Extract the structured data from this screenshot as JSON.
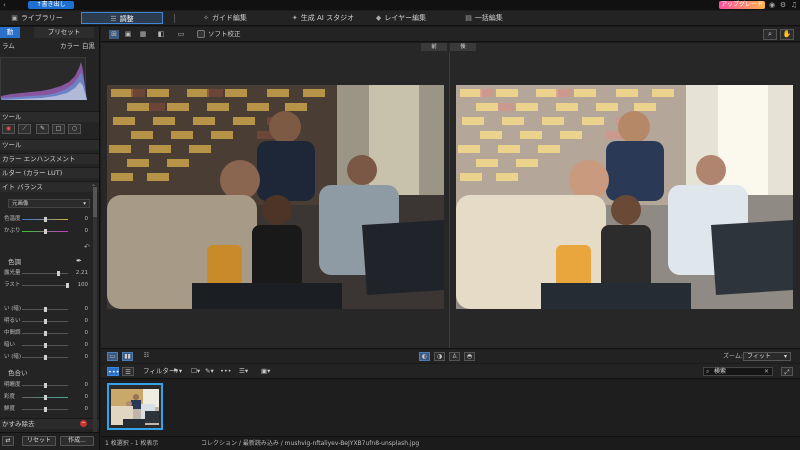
{
  "topbar": {
    "back_icon": "arrow-left-icon",
    "title_button": "↑書き出し",
    "upgrade_label": "アップグレード",
    "icons": [
      "account-icon",
      "gear-icon",
      "bell-icon",
      "help-icon"
    ]
  },
  "tabs": [
    {
      "label": "ライブラリー",
      "icon": "▣"
    },
    {
      "label": "調整",
      "icon": "☰",
      "active": true
    },
    {
      "label": "ガイド編集",
      "icon": "✧"
    },
    {
      "label": "生成 AI スタジオ",
      "icon": "✦"
    },
    {
      "label": "レイヤー編集",
      "icon": "◆"
    },
    {
      "label": "一括編集",
      "icon": "▤"
    }
  ],
  "left_panel": {
    "subtabs": [
      "動",
      "プリセット"
    ],
    "histogram_label": "ラム",
    "histogram_modes": [
      "カラー",
      "白黒"
    ],
    "tools_label": "ツール",
    "tools": [
      "eye-icon",
      "brush-icon",
      "pen-icon",
      "square-icon",
      "circle-icon"
    ],
    "section_tools": "ツール",
    "sections": [
      "カラー エンハンスメント",
      "ルター (カラー LUT)",
      "イト バランス"
    ],
    "wb_dropdown": "元画像",
    "wb_sliders": [
      {
        "label": "色温度",
        "value": "0"
      },
      {
        "label": "かぶり",
        "value": "0"
      }
    ],
    "tone_header": "色調",
    "tone_sliders": [
      {
        "label": "露光量",
        "value": "2.21"
      },
      {
        "label": "ラスト",
        "value": "100"
      }
    ],
    "tone_sliders2": [
      {
        "label": "い (暗)",
        "value": "0"
      },
      {
        "label": "明るい",
        "value": "0"
      },
      {
        "label": "中間調",
        "value": "0"
      },
      {
        "label": "暗い",
        "value": "0"
      },
      {
        "label": "い (暗)",
        "value": "0"
      }
    ],
    "color_header": "色合い",
    "color_sliders": [
      {
        "label": "明瞭度",
        "value": "0"
      },
      {
        "label": "彩度",
        "value": "0"
      },
      {
        "label": "鮮度",
        "value": "0"
      }
    ],
    "dehaze_label": "かすみ除去",
    "footer_reset": "リセット",
    "footer_create": "作成..."
  },
  "toolbar": {
    "soft_proof_label": "ソフト校正",
    "before_label": "前",
    "after_label": "後"
  },
  "viewbar": {
    "zoom_label": "ズーム:",
    "zoom_value": "フィット"
  },
  "filmbar": {
    "filter_label": "フィルター:",
    "search_value": "検索"
  },
  "status": {
    "selection": "1 枚選択 - 1 枚表示",
    "path": "コレクション / 最新読み込み / mushvig-nftaliyev-BeJYXB7ufn8-unsplash.jpg"
  },
  "colors": {
    "accent": "#2a6fc9",
    "upgrade_start": "#ff4fa0",
    "upgrade_end": "#ffb34a",
    "thumb_border": "#36a3e8"
  }
}
